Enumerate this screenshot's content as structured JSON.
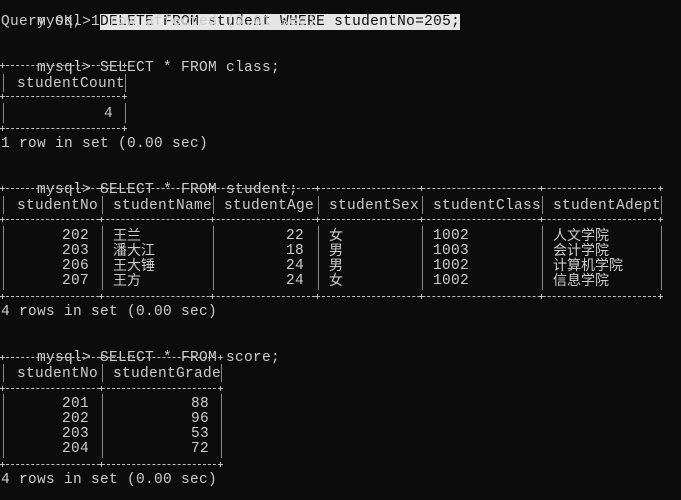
{
  "terminal": {
    "prompt": "mysql> ",
    "commands": [
      {
        "sql": "DELETE FROM student WHERE studentNo=205;",
        "result": "Query OK, 1 row affected (0.01 sec)"
      },
      {
        "sql": "SELECT * FROM class;",
        "table": {
          "headers": [
            "studentCount"
          ],
          "rows": [
            [
              "4"
            ]
          ]
        },
        "result": "1 row in set (0.00 sec)"
      },
      {
        "sql": "SELECT * FROM student;",
        "table": {
          "headers": [
            "studentNo",
            "studentName",
            "studentAge",
            "studentSex",
            "studentClass",
            "studentAdept"
          ],
          "rows": [
            [
              "202",
              "王兰",
              "22",
              "女",
              "1002",
              "人文学院"
            ],
            [
              "203",
              "潘大江",
              "18",
              "男",
              "1003",
              "会计学院"
            ],
            [
              "206",
              "王大锤",
              "24",
              "男",
              "1002",
              "计算机学院"
            ],
            [
              "207",
              "王方",
              "24",
              "女",
              "1002",
              "信息学院"
            ]
          ]
        },
        "result": "4 rows in set (0.00 sec)"
      },
      {
        "sql": "SELECT * FROM score;",
        "table": {
          "headers": [
            "studentNo",
            "studentGrade"
          ],
          "rows": [
            [
              "201",
              "88"
            ],
            [
              "202",
              "96"
            ],
            [
              "203",
              "53"
            ],
            [
              "204",
              "72"
            ]
          ]
        },
        "result": "4 rows in set (0.00 sec)"
      }
    ]
  }
}
